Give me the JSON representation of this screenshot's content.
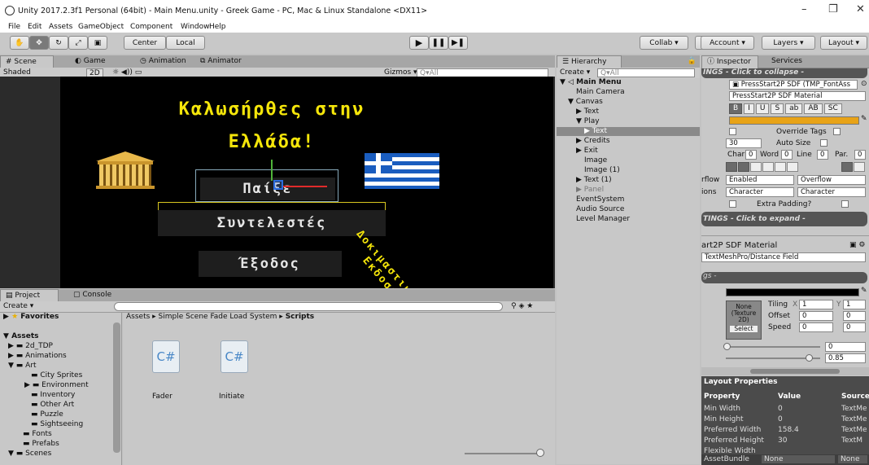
{
  "window": {
    "title": "Unity 2017.2.3f1 Personal (64bit) - Main Menu.unity - Greek Game - PC, Mac & Linux Standalone <DX11>",
    "minimize": "–",
    "maximize": "❐",
    "close": "✕"
  },
  "menu": [
    "File",
    "Edit",
    "Assets",
    "GameObject",
    "Component",
    "Window",
    "Help"
  ],
  "toolbar": {
    "center": "Center",
    "local": "Local",
    "collab": "Collab ▾",
    "account": "Account ▾",
    "layers": "Layers ▾",
    "layout": "Layout ▾"
  },
  "scene": {
    "tabs": [
      "Scene",
      "Game",
      "Animation",
      "Animator"
    ],
    "shading": "Shaded",
    "mode2d": "2D",
    "gizmos": "Gizmos ▾",
    "search": "Q▾All"
  },
  "game": {
    "title1": "Καλωσήρθες στην",
    "title2": "Ελλάδα!",
    "btn_play": "Παίξε",
    "btn_credits": "Συντελεστές",
    "btn_exit": "Έξοδος",
    "diag1": "Δοκιμαστική",
    "diag2": "Εκδοση"
  },
  "hierarchy": {
    "tab": "Hierarchy",
    "create": "Create ▾",
    "search": "Q▾All",
    "items": [
      "Main Menu",
      "Main Camera",
      "Canvas",
      "Text",
      "Play",
      "Text",
      "Credits",
      "Exit",
      "Image",
      "Image (1)",
      "Text (1)",
      "Panel",
      "EventSystem",
      "Audio Source",
      "Level Manager"
    ]
  },
  "project": {
    "tabs": [
      "Project",
      "Console"
    ],
    "create": "Create ▾",
    "breadcrumb": [
      "Assets",
      "Simple Scene Fade Load System",
      "Scripts"
    ],
    "favorites": "Favorites",
    "tree": [
      "Assets",
      "2d_TDP",
      "Animations",
      "Art",
      "City Sprites",
      "Environment",
      "Inventory",
      "Other Art",
      "Puzzle",
      "Sightseeing",
      "Fonts",
      "Prefabs",
      "Scenes"
    ],
    "files": [
      "Fader",
      "Initiate"
    ],
    "file_icon": "C#"
  },
  "inspector": {
    "tabs": [
      "Inspector",
      "Services"
    ],
    "settings_collapse": "INGS - Click to collapse -",
    "font_asset": "PressStart2P SDF (TMP_FontAss",
    "material": "PressStart2P SDF Material",
    "styles": [
      "B",
      "I",
      "U",
      "S",
      "ab",
      "AB",
      "SC"
    ],
    "override_tags": "Override Tags",
    "font_size": "30",
    "auto_size": "Auto Size",
    "char": "Char",
    "char_v": "0",
    "word": "Word",
    "word_v": "0",
    "line": "Line",
    "line_v": "0",
    "par": "Par.",
    "par_v": "0",
    "wrap_label": "rflow",
    "wrap_val": "Enabled",
    "overflow_val": "Overflow",
    "mapping_label": "ions",
    "mapping_h": "Character",
    "mapping_v": "Character",
    "extra_padding": "Extra Padding?",
    "expand": "TINGS - Click to expand -",
    "mat_title": "art2P SDF Material",
    "shader": "TextMeshPro/Distance Field",
    "section": "gs -",
    "tex_none": "None",
    "tex_type": "(Texture 2D)",
    "tex_select": "Select",
    "tiling": "Tiling",
    "tiling_x": "1",
    "tiling_y": "1",
    "offset": "Offset",
    "offset_x": "0",
    "offset_y": "0",
    "speed": "Speed",
    "speed_x": "0",
    "speed_y": "0",
    "slider1_val": "0",
    "slider2_val": "0.85",
    "layout_title": "Layout Properties",
    "layout_cols": [
      "Property",
      "Value",
      "Source"
    ],
    "layout_rows": [
      [
        "Min Width",
        "0",
        "TextMe"
      ],
      [
        "Min Height",
        "0",
        "TextMe"
      ],
      [
        "Preferred Width",
        "158.4",
        "TextMe"
      ],
      [
        "Preferred Height",
        "30",
        "TextM"
      ],
      [
        "Flexible Width",
        "",
        ""
      ]
    ],
    "assetbundle": "AssetBundle",
    "ab_none1": "None",
    "ab_none2": "None"
  },
  "colors": {
    "face": "#e8a317",
    "yellow": "#f5e60a"
  }
}
